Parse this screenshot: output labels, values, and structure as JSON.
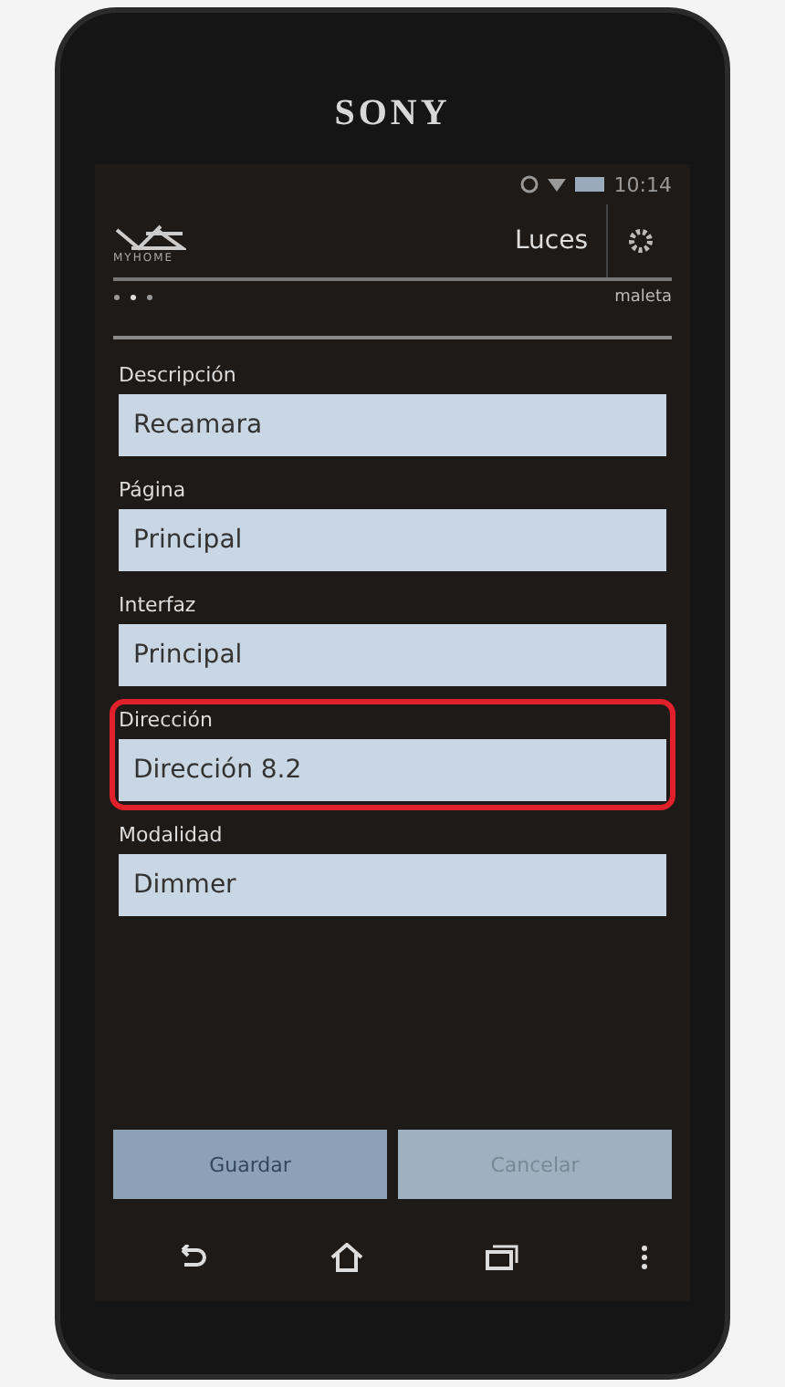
{
  "device": {
    "brand": "SONY"
  },
  "status_bar": {
    "time": "10:14"
  },
  "app_bar": {
    "logo_text": "MYHOME",
    "title": "Luces",
    "subtitle": "maleta"
  },
  "fields": [
    {
      "label": "Descripción",
      "value": "Recamara",
      "highlighted": false
    },
    {
      "label": "Página",
      "value": "Principal",
      "highlighted": false
    },
    {
      "label": "Interfaz",
      "value": "Principal",
      "highlighted": false
    },
    {
      "label": "Dirección",
      "value": "Dirección 8.2",
      "highlighted": true
    },
    {
      "label": "Modalidad",
      "value": "Dimmer",
      "highlighted": false
    }
  ],
  "buttons": [
    {
      "label": "Guardar",
      "disabled": false
    },
    {
      "label": "Cancelar",
      "disabled": true
    }
  ]
}
